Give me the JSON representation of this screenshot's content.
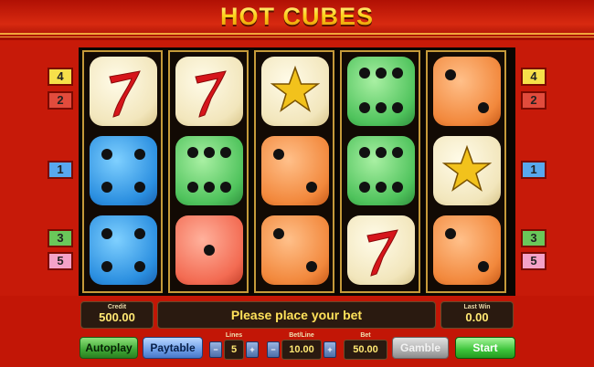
{
  "title": "HOT CUBES",
  "reels": [
    [
      {
        "color": "cream",
        "symbol": "seven"
      },
      {
        "color": "blue",
        "symbol": "4"
      },
      {
        "color": "blue",
        "symbol": "4"
      }
    ],
    [
      {
        "color": "cream",
        "symbol": "seven"
      },
      {
        "color": "green",
        "symbol": "6"
      },
      {
        "color": "salmon",
        "symbol": "1"
      }
    ],
    [
      {
        "color": "cream",
        "symbol": "star"
      },
      {
        "color": "orange",
        "symbol": "2"
      },
      {
        "color": "orange",
        "symbol": "2"
      }
    ],
    [
      {
        "color": "green",
        "symbol": "6"
      },
      {
        "color": "green",
        "symbol": "6"
      },
      {
        "color": "cream",
        "symbol": "seven"
      }
    ],
    [
      {
        "color": "orange",
        "symbol": "2"
      },
      {
        "color": "cream",
        "symbol": "star"
      },
      {
        "color": "orange",
        "symbol": "2"
      }
    ]
  ],
  "paylines_left": [
    {
      "label": "4",
      "color": "yellow"
    },
    {
      "label": "2",
      "color": "red"
    },
    {
      "label": "1",
      "color": "blue"
    },
    {
      "label": "3",
      "color": "green"
    },
    {
      "label": "5",
      "color": "pink"
    }
  ],
  "paylines_right": [
    {
      "label": "4",
      "color": "yellow"
    },
    {
      "label": "2",
      "color": "red"
    },
    {
      "label": "1",
      "color": "blue"
    },
    {
      "label": "3",
      "color": "green"
    },
    {
      "label": "5",
      "color": "pink"
    }
  ],
  "credit": {
    "label": "Credit",
    "value": "500.00"
  },
  "message": "Please place your bet",
  "last_win": {
    "label": "Last Win",
    "value": "0.00"
  },
  "buttons": {
    "autoplay": "Autoplay",
    "paytable": "Paytable",
    "gamble": "Gamble",
    "start": "Start"
  },
  "lines": {
    "label": "Lines",
    "value": "5"
  },
  "bet_line": {
    "label": "Bet/Line",
    "value": "10.00"
  },
  "bet": {
    "label": "Bet",
    "value": "50.00"
  }
}
